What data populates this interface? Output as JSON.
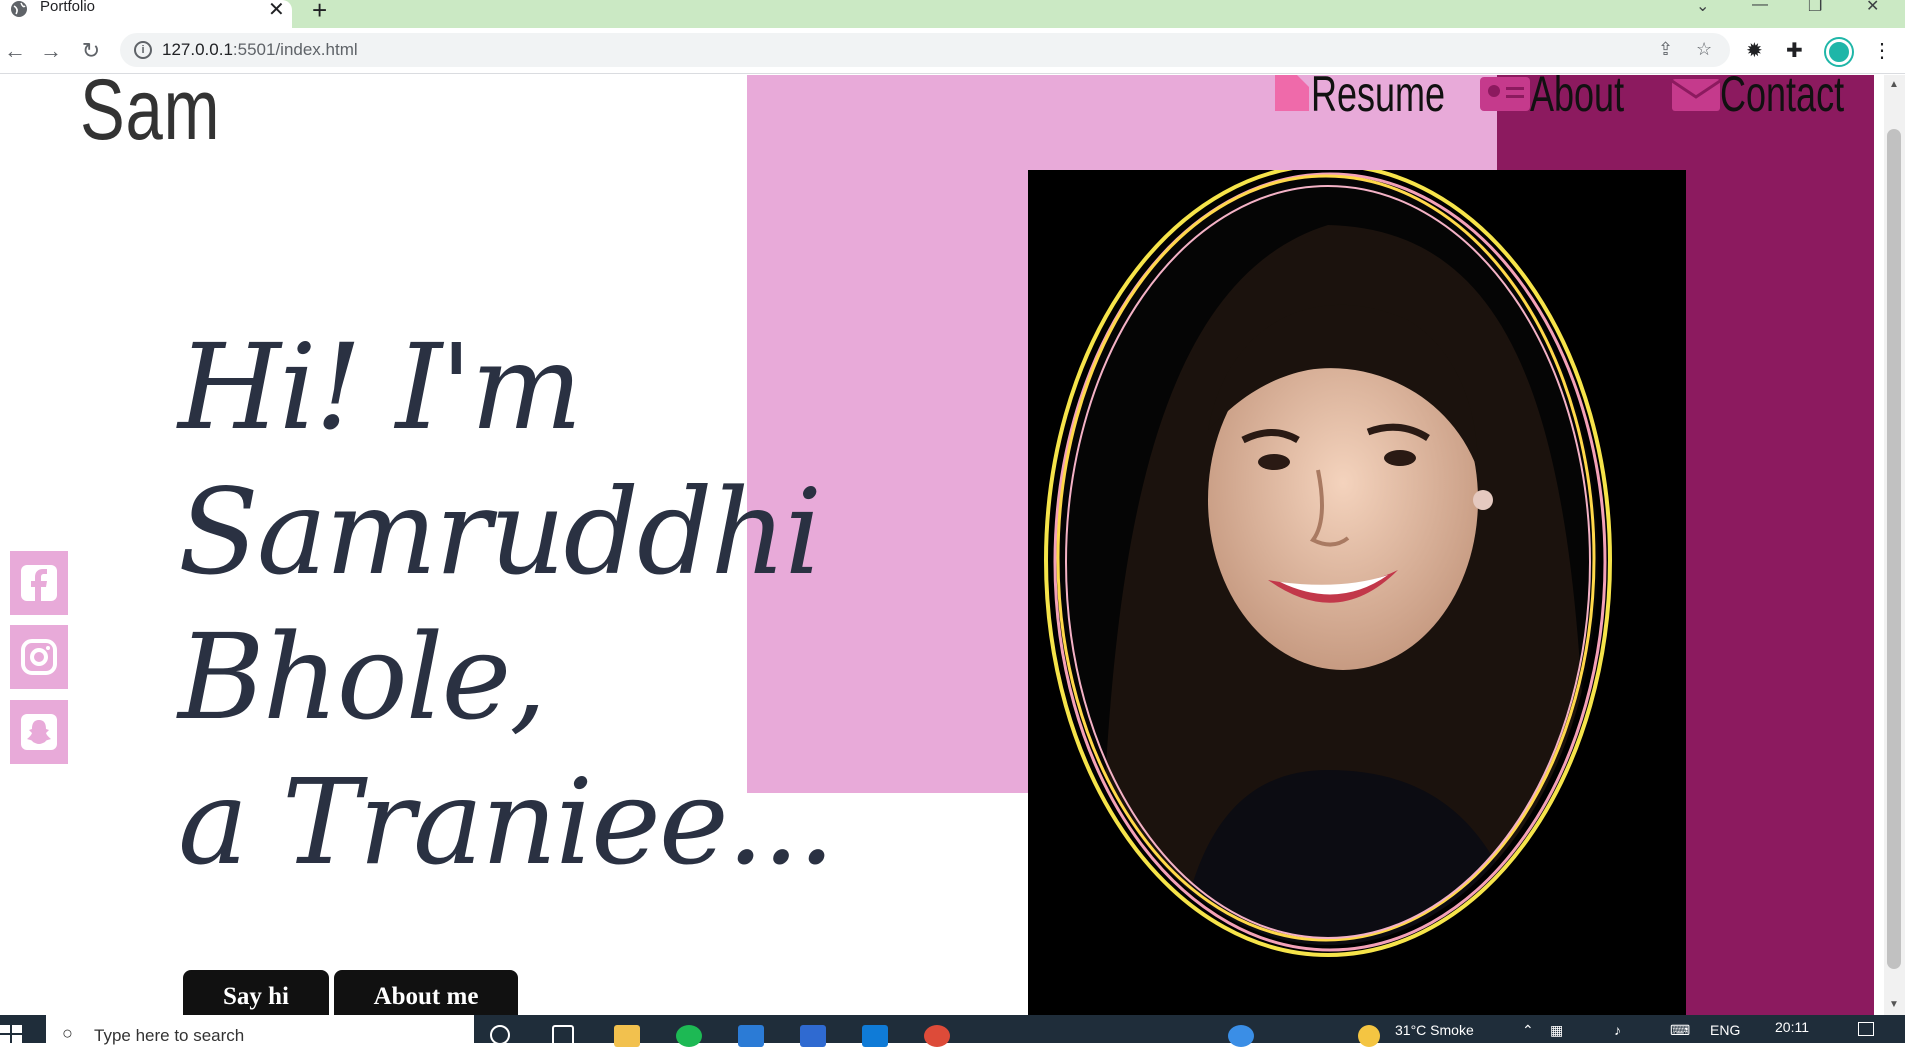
{
  "browser": {
    "tab_title": "Portfolio",
    "url_host": "127.0.0.1",
    "url_rest": ":5501/index.html",
    "new_tab": "+"
  },
  "site": {
    "logo": "Sam",
    "nav": [
      {
        "label": "Resume",
        "icon": "file-icon"
      },
      {
        "label": "About",
        "icon": "user-card-icon"
      },
      {
        "label": "Contact",
        "icon": "envelope-icon"
      }
    ],
    "hero_lines": [
      "Hi! I'm",
      "Samruddhi",
      "Bhole,",
      "a Traniee..."
    ],
    "buttons": {
      "say_hi": "Say hi",
      "about_me": "About me"
    },
    "social": [
      "facebook-icon",
      "instagram-icon",
      "snapchat-icon"
    ],
    "colors": {
      "pink": "#e8aad9",
      "purple": "#8c1a5f",
      "text": "#2a3142"
    }
  },
  "taskbar": {
    "search_placeholder": "Type here to search",
    "weather": "31°C  Smoke",
    "lang": "ENG",
    "time": "20:11"
  }
}
